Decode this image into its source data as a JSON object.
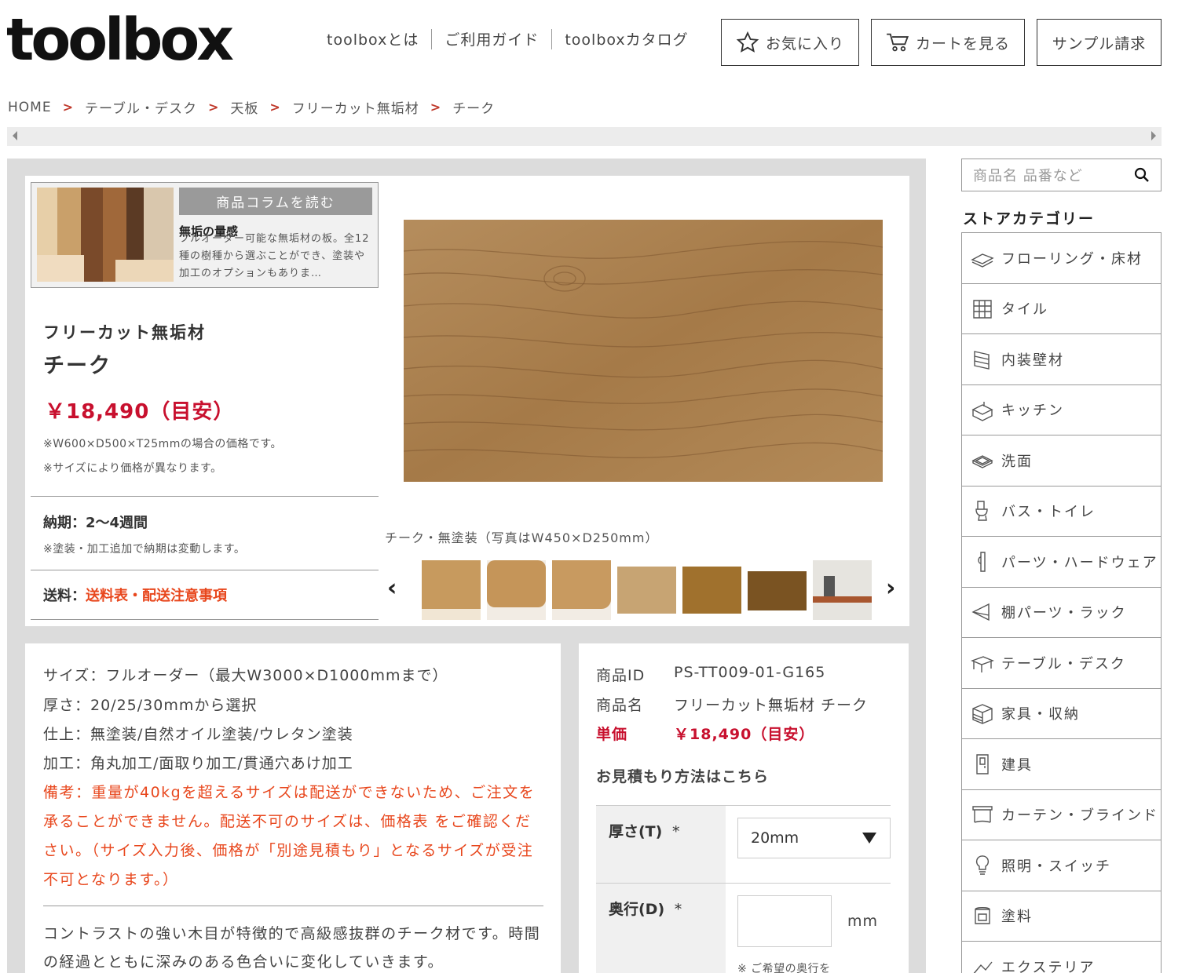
{
  "header": {
    "logo": "toolbox",
    "nav": [
      "toolboxとは",
      "ご利用ガイド",
      "toolboxカタログ"
    ],
    "buttons": {
      "favorite": "お気に入り",
      "cart": "カートを見る",
      "sample": "サンプル請求"
    }
  },
  "breadcrumb": [
    "HOME",
    "テーブル・デスク",
    "天板",
    "フリーカット無垢材",
    "チーク"
  ],
  "column": {
    "button": "商品コラムを読む",
    "title": "無垢の量感",
    "text": "フルオーダー可能な無垢材の板。全12種の樹種から選ぶことができ、塗装や加工のオプションもありま…"
  },
  "product": {
    "category": "フリーカット無垢材",
    "name": "チーク",
    "price": "￥18,490（目安）",
    "price_notes": [
      "※W600×D500×T25mmの場合の価格です。",
      "※サイズにより価格が異なります。"
    ],
    "lead_time_label": "納期：",
    "lead_time": "2〜4週間",
    "lead_time_note": "※塗装・加工追加で納期は変動します。",
    "shipping_label": "送料：",
    "shipping_link": "送料表・配送注意事項",
    "image_caption": "チーク・無塗装（写真はW450×D250mm）"
  },
  "specs": {
    "lines": [
      "サイズ：フルオーダー（最大W3000×D1000mmまで）",
      "厚さ：20/25/30mmから選択",
      "仕上：無塗装/自然オイル塗装/ウレタン塗装",
      "加工：角丸加工/面取り加工/貫通穴あけ加工"
    ],
    "remark_pre": "備考：重量が40kgを超えるサイズは配送ができないため、ご注文を承ることができません。配送不可のサイズは、",
    "remark_link": "価格表",
    "remark_post": " をご確認ください。（サイズ入力後、価格が「別途見積もり」となるサイズが受注不可となります。）",
    "description": "コントラストの強い木目が特徴的で高級感抜群のチーク材です。時間の経過とともに深みのある色合いに変化していきます。"
  },
  "buy": {
    "id_label": "商品ID",
    "id_value": "PS-TT009-01-G165",
    "name_label": "商品名",
    "name_value": "フリーカット無垢材 チーク",
    "price_label": "単価",
    "price_value": "￥18,490（目安）",
    "estimate_link": "お見積もり方法はこちら",
    "thickness_label": "厚さ(T)",
    "thickness_value": "20mm",
    "depth_label": "奥行(D)",
    "depth_unit": "mm",
    "depth_note": "※ ご希望の奥行を",
    "required_mark": "*"
  },
  "sidebar": {
    "search_placeholder": "商品名 品番など",
    "store_title": "ストアカテゴリー",
    "categories": [
      "フローリング・床材",
      "タイル",
      "内装壁材",
      "キッチン",
      "洗面",
      "バス・トイレ",
      "パーツ・ハードウェア",
      "棚パーツ・ラック",
      "テーブル・デスク",
      "家具・収納",
      "建具",
      "カーテン・ブラインド",
      "照明・スイッチ",
      "塗料",
      "エクステリア"
    ]
  },
  "colors": {
    "accent_red": "#c8102e",
    "accent_orange": "#e8471d",
    "panel_gray": "#dcdcdc"
  }
}
